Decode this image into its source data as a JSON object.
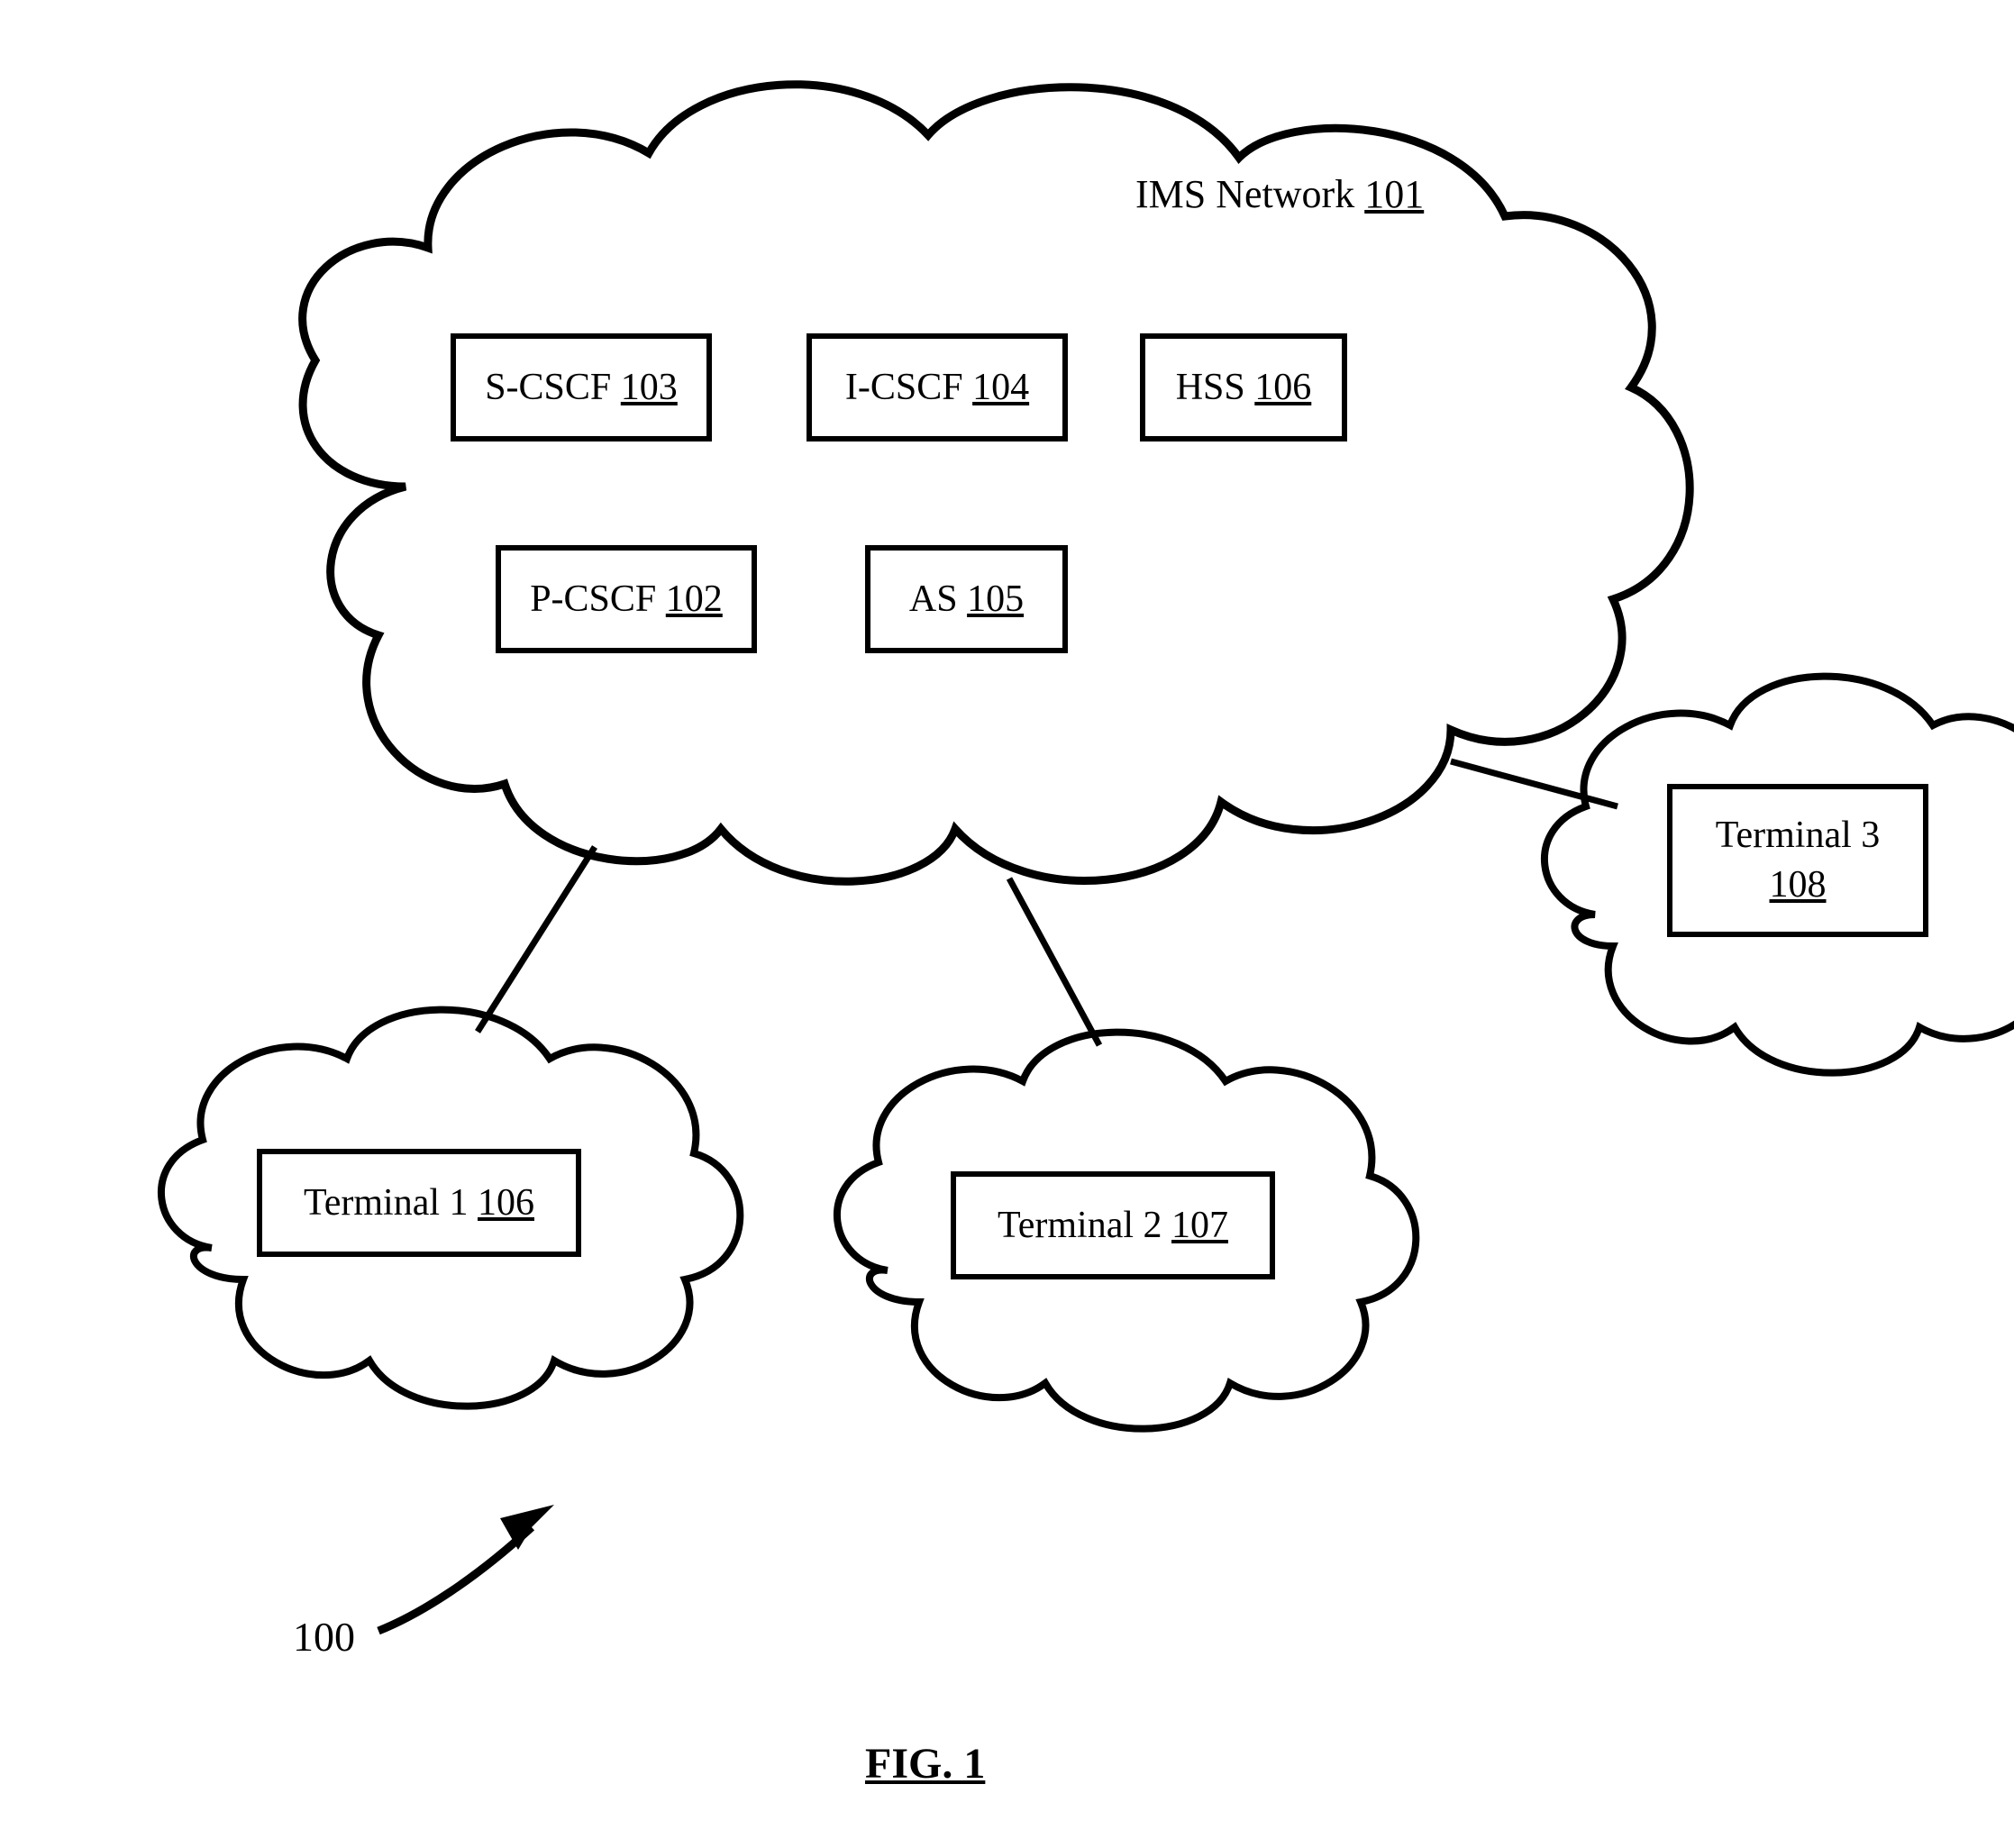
{
  "imsNetwork": {
    "label": "IMS Network",
    "ref": "101"
  },
  "boxes": {
    "scscf": {
      "label": "S-CSCF",
      "ref": "103"
    },
    "icscf": {
      "label": "I-CSCF",
      "ref": "104"
    },
    "hss": {
      "label": "HSS",
      "ref": "106"
    },
    "pcscf": {
      "label": "P-CSCF",
      "ref": "102"
    },
    "as": {
      "label": "AS",
      "ref": "105"
    },
    "term1": {
      "label": "Terminal 1",
      "ref": "106"
    },
    "term2": {
      "label": "Terminal 2",
      "ref": "107"
    },
    "term3": {
      "label": "Terminal 3",
      "ref": "108"
    }
  },
  "figure": {
    "systemRef": "100",
    "caption": "FIG. 1"
  }
}
